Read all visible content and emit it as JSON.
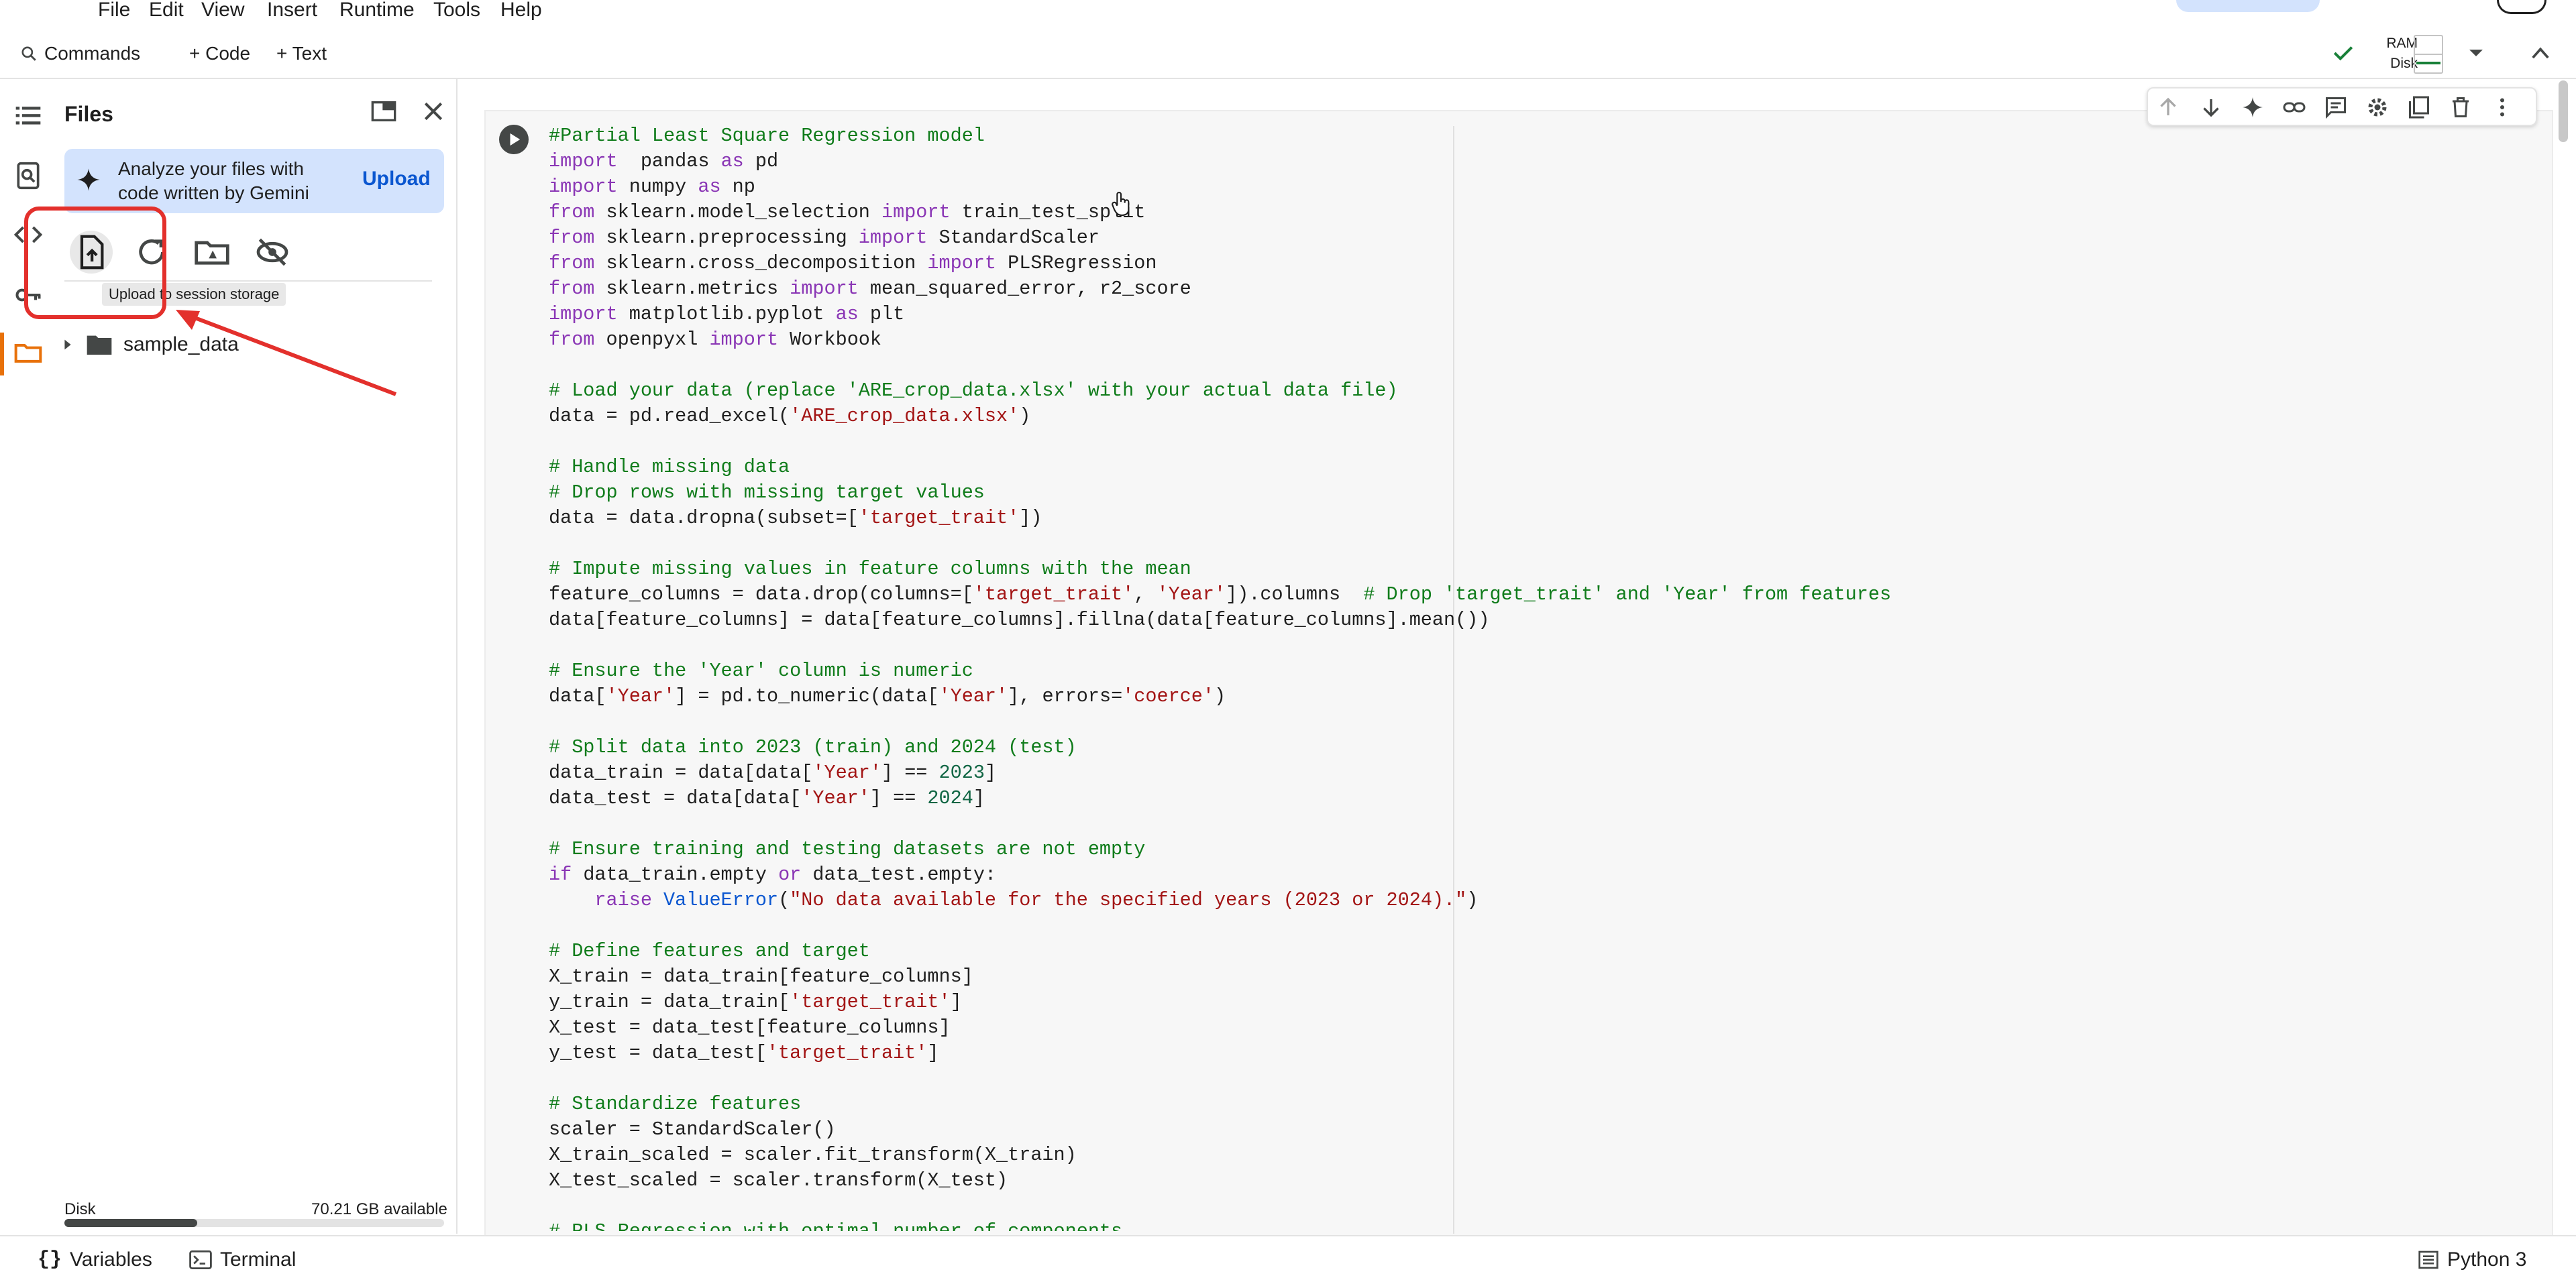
{
  "menu": {
    "items": [
      "File",
      "Edit",
      "View",
      "Insert",
      "Runtime",
      "Tools",
      "Help"
    ]
  },
  "toolbar": {
    "commands_label": "Commands",
    "code_label": "+ Code",
    "text_label": "+ Text"
  },
  "resources": {
    "ram_label": "RAM",
    "disk_label": "Disk"
  },
  "files_panel": {
    "title": "Files",
    "gemini_text": "Analyze your files with code written by Gemini",
    "upload_label": "Upload",
    "tooltip": "Upload to session storage",
    "tree": [
      {
        "name": "sample_data"
      }
    ],
    "disk_label": "Disk",
    "disk_available": "70.21 GB available",
    "disk_usage_fraction": 0.35
  },
  "statusbar": {
    "variables_label": "Variables",
    "terminal_label": "Terminal",
    "runtime_label": "Python 3"
  },
  "colors": {
    "accent_blue": "#0b57d0",
    "highlight_red": "#e3302c",
    "ok_green": "#188038",
    "keyword_purple": "#8a36b5",
    "comment_green": "#107c1b",
    "string_red": "#a31515"
  },
  "icons": [
    "toc-icon",
    "find-icon",
    "code-snippets-icon",
    "secrets-key-icon",
    "folder-icon",
    "upload-file-icon",
    "refresh-icon",
    "mount-drive-icon",
    "hide-icon",
    "sparkle-icon",
    "play-icon",
    "arrow-up-icon",
    "arrow-down-icon",
    "link-icon",
    "comment-icon",
    "gear-icon",
    "mirror-cell-icon",
    "trash-icon",
    "more-vert-icon",
    "check-icon"
  ],
  "code_lines": [
    [
      [
        "cm",
        "#Partial Least Square Regression model"
      ]
    ],
    [
      [
        "kw",
        "import"
      ],
      [
        "",
        "  pandas "
      ],
      [
        "kw",
        "as"
      ],
      [
        "",
        " pd"
      ]
    ],
    [
      [
        "kw",
        "import"
      ],
      [
        "",
        "",
        " numpy "
      ],
      [
        "kw",
        "as"
      ],
      [
        "",
        " np"
      ]
    ],
    [
      [
        "kw",
        "from"
      ],
      [
        "",
        " sklearn.model_selection "
      ],
      [
        "kw",
        "import"
      ],
      [
        "",
        " train_test_split"
      ]
    ],
    [
      [
        "kw",
        "from"
      ],
      [
        "",
        " sklearn.preprocessing "
      ],
      [
        "kw",
        "import"
      ],
      [
        "",
        " StandardScaler"
      ]
    ],
    [
      [
        "kw",
        "from"
      ],
      [
        "",
        " sklearn.cross_decomposition "
      ],
      [
        "kw",
        "import"
      ],
      [
        "",
        " PLSRegression"
      ]
    ],
    [
      [
        "kw",
        "from"
      ],
      [
        "",
        " sklearn.metrics "
      ],
      [
        "kw",
        "import"
      ],
      [
        "",
        " mean_squared_error, r2_score"
      ]
    ],
    [
      [
        "kw",
        "import"
      ],
      [
        "",
        " matplotlib.pyplot "
      ],
      [
        "kw",
        "as"
      ],
      [
        "",
        " plt"
      ]
    ],
    [
      [
        "kw",
        "from"
      ],
      [
        "",
        " openpyxl "
      ],
      [
        "kw",
        "import"
      ],
      [
        "",
        " Workbook"
      ]
    ],
    [
      [
        "",
        ""
      ]
    ],
    [
      [
        "cm",
        "# Load your data (replace 'ARE_crop_data.xlsx' with your actual data file)"
      ]
    ],
    [
      [
        "",
        "data = pd.read_excel("
      ],
      [
        "st",
        "'ARE_crop_data.xlsx'"
      ],
      [
        "",
        ")"
      ]
    ],
    [
      [
        "",
        ""
      ]
    ],
    [
      [
        "cm",
        "# Handle missing data"
      ]
    ],
    [
      [
        "cm",
        "# Drop rows with missing target values"
      ]
    ],
    [
      [
        "",
        "data = data.dropna(subset=["
      ],
      [
        "st",
        "'target_trait'"
      ],
      [
        "",
        "])"
      ]
    ],
    [
      [
        "",
        ""
      ]
    ],
    [
      [
        "cm",
        "# Impute missing values in feature columns with the mean"
      ]
    ],
    [
      [
        "",
        "feature_columns = data.drop(columns=["
      ],
      [
        "st",
        "'target_trait'"
      ],
      [
        "",
        ", "
      ],
      [
        "st",
        "'Year'"
      ],
      [
        "",
        "]).columns  "
      ],
      [
        "cm",
        "# Drop 'target_trait' and 'Year' from features"
      ]
    ],
    [
      [
        "",
        "data[feature_columns] = data[feature_columns].fillna(data[feature_columns].mean())"
      ]
    ],
    [
      [
        "",
        ""
      ]
    ],
    [
      [
        "cm",
        "# Ensure the 'Year' column is numeric"
      ]
    ],
    [
      [
        "",
        "data["
      ],
      [
        "st",
        "'Year'"
      ],
      [
        "",
        "] = pd.to_numeric(data["
      ],
      [
        "st",
        "'Year'"
      ],
      [
        "",
        "], errors="
      ],
      [
        "st",
        "'coerce'"
      ],
      [
        "",
        ")"
      ]
    ],
    [
      [
        "",
        ""
      ]
    ],
    [
      [
        "cm",
        "# Split data into 2023 (train) and 2024 (test)"
      ]
    ],
    [
      [
        "",
        "data_train = data[data["
      ],
      [
        "st",
        "'Year'"
      ],
      [
        "",
        "] == "
      ],
      [
        "nm",
        "2023"
      ],
      [
        "",
        "]"
      ]
    ],
    [
      [
        "",
        "data_test = data[data["
      ],
      [
        "st",
        "'Year'"
      ],
      [
        "",
        "] == "
      ],
      [
        "nm",
        "2024"
      ],
      [
        "",
        "]"
      ]
    ],
    [
      [
        "",
        ""
      ]
    ],
    [
      [
        "cm",
        "# Ensure training and testing datasets are not empty"
      ]
    ],
    [
      [
        "kw",
        "if"
      ],
      [
        "",
        " data_train.empty "
      ],
      [
        "kw",
        "or"
      ],
      [
        "",
        " data_test.empty:"
      ]
    ],
    [
      [
        "",
        "    "
      ],
      [
        "kw",
        "raise"
      ],
      [
        "",
        " "
      ],
      [
        "bl",
        "ValueError"
      ],
      [
        "",
        "("
      ],
      [
        "st",
        "\"No data available for the specified years (2023 or 2024).\""
      ],
      [
        "",
        ")"
      ]
    ],
    [
      [
        "",
        ""
      ]
    ],
    [
      [
        "cm",
        "# Define features and target"
      ]
    ],
    [
      [
        "",
        "X_train = data_train[feature_columns]"
      ]
    ],
    [
      [
        "",
        "y_train = data_train["
      ],
      [
        "st",
        "'target_trait'"
      ],
      [
        "",
        "]"
      ]
    ],
    [
      [
        "",
        "X_test = data_test[feature_columns]"
      ]
    ],
    [
      [
        "",
        "y_test = data_test["
      ],
      [
        "st",
        "'target_trait'"
      ],
      [
        "",
        "]"
      ]
    ],
    [
      [
        "",
        ""
      ]
    ],
    [
      [
        "cm",
        "# Standardize features"
      ]
    ],
    [
      [
        "",
        "scaler = StandardScaler()"
      ]
    ],
    [
      [
        "",
        "X_train_scaled = scaler.fit_transform(X_train)"
      ]
    ],
    [
      [
        "",
        "X_test_scaled = scaler.transform(X_test)"
      ]
    ],
    [
      [
        "",
        ""
      ]
    ],
    [
      [
        "cm",
        "# PLS Regression with optimal number of components"
      ]
    ]
  ]
}
